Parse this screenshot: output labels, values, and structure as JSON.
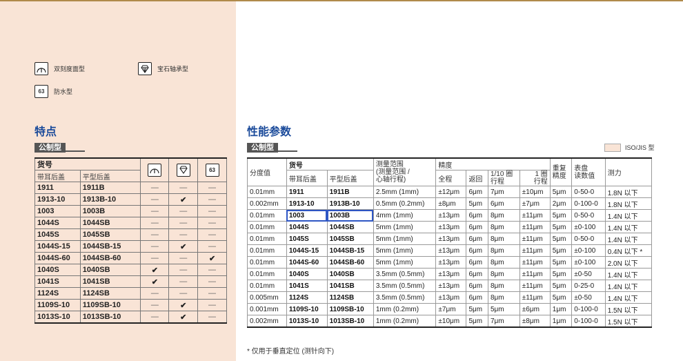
{
  "legend": {
    "items": [
      {
        "icon": "dual-dial-icon",
        "label": "双刻度面型"
      },
      {
        "icon": "jewel-bearing-icon",
        "label": "宝石轴承型"
      },
      {
        "icon": "waterproof-63-icon",
        "label": "防水型",
        "icon_text": "63"
      }
    ]
  },
  "features": {
    "title": "特点",
    "tag": "公制型",
    "header": {
      "item_no": "货号",
      "with_lug": "带耳后盖",
      "flat_back": "平型后盖"
    },
    "rows": [
      {
        "a": "1911",
        "b": "1911B",
        "m1": "—",
        "m2": "—",
        "m3": "—"
      },
      {
        "a": "1913-10",
        "b": "1913B-10",
        "m1": "—",
        "m2": "✔",
        "m3": "—"
      },
      {
        "a": "1003",
        "b": "1003B",
        "m1": "—",
        "m2": "—",
        "m3": "—"
      },
      {
        "a": "1044S",
        "b": "1044SB",
        "m1": "—",
        "m2": "—",
        "m3": "—"
      },
      {
        "a": "1045S",
        "b": "1045SB",
        "m1": "—",
        "m2": "—",
        "m3": "—"
      },
      {
        "a": "1044S-15",
        "b": "1044SB-15",
        "m1": "—",
        "m2": "✔",
        "m3": "—"
      },
      {
        "a": "1044S-60",
        "b": "1044SB-60",
        "m1": "—",
        "m2": "—",
        "m3": "✔"
      },
      {
        "a": "1040S",
        "b": "1040SB",
        "m1": "✔",
        "m2": "—",
        "m3": "—"
      },
      {
        "a": "1041S",
        "b": "1041SB",
        "m1": "✔",
        "m2": "—",
        "m3": "—"
      },
      {
        "a": "1124S",
        "b": "1124SB",
        "m1": "—",
        "m2": "—",
        "m3": "—"
      },
      {
        "a": "1109S-10",
        "b": "1109SB-10",
        "m1": "—",
        "m2": "✔",
        "m3": "—"
      },
      {
        "a": "1013S-10",
        "b": "1013SB-10",
        "m1": "—",
        "m2": "✔",
        "m3": "—"
      }
    ]
  },
  "performance": {
    "title": "性能参数",
    "tag": "公制型",
    "iso_legend": "ISO/JIS 型",
    "header": {
      "graduation": "分度值",
      "item_no": "货号",
      "with_lug": "带耳后盖",
      "flat_back": "平型后盖",
      "range": "测量范围\n(测量范围 /\n心轴行程)",
      "accuracy": "精度",
      "full": "全程",
      "retrace": "返回",
      "tenth": "1/10 圈\n行程",
      "one_rev": "1 圈\n行程",
      "repeat": "重复\n精度",
      "dial": "表盘\n读数值",
      "force": "测力"
    },
    "rows": [
      [
        "0.01mm",
        "1911",
        "1911B",
        "2.5mm (1mm)",
        "±12μm",
        "6μm",
        "7μm",
        "±10μm",
        "5μm",
        "0-50-0",
        "1.8N 以下"
      ],
      [
        "0.002mm",
        "1913-10",
        "1913B-10",
        "0.5mm (0.2mm)",
        "±8μm",
        "5μm",
        "6μm",
        "±7μm",
        "2μm",
        "0-100-0",
        "1.8N 以下"
      ],
      [
        "0.01mm",
        "1003",
        "1003B",
        "4mm (1mm)",
        "±13μm",
        "6μm",
        "8μm",
        "±11μm",
        "5μm",
        "0-50-0",
        "1.4N 以下"
      ],
      [
        "0.01mm",
        "1044S",
        "1044SB",
        "5mm (1mm)",
        "±13μm",
        "6μm",
        "8μm",
        "±11μm",
        "5μm",
        "±0-100",
        "1.4N 以下"
      ],
      [
        "0.01mm",
        "1045S",
        "1045SB",
        "5mm (1mm)",
        "±13μm",
        "6μm",
        "8μm",
        "±11μm",
        "5μm",
        "0-50-0",
        "1.4N 以下"
      ],
      [
        "0.01mm",
        "1044S-15",
        "1044SB-15",
        "5mm (1mm)",
        "±13μm",
        "6μm",
        "8μm",
        "±11μm",
        "5μm",
        "±0-100",
        "0.4N 以下 *"
      ],
      [
        "0.01mm",
        "1044S-60",
        "1044SB-60",
        "5mm (1mm)",
        "±13μm",
        "6μm",
        "8μm",
        "±11μm",
        "5μm",
        "±0-100",
        "2.0N 以下"
      ],
      [
        "0.01mm",
        "1040S",
        "1040SB",
        "3.5mm (0.5mm)",
        "±13μm",
        "6μm",
        "8μm",
        "±11μm",
        "5μm",
        "±0-50",
        "1.4N 以下"
      ],
      [
        "0.01mm",
        "1041S",
        "1041SB",
        "3.5mm (0.5mm)",
        "±13μm",
        "6μm",
        "8μm",
        "±11μm",
        "5μm",
        "0-25-0",
        "1.4N 以下"
      ],
      [
        "0.005mm",
        "1124S",
        "1124SB",
        "3.5mm (0.5mm)",
        "±13μm",
        "6μm",
        "8μm",
        "±11μm",
        "5μm",
        "±0-50",
        "1.4N 以下"
      ],
      [
        "0.001mm",
        "1109S-10",
        "1109SB-10",
        "1mm (0.2mm)",
        "±7μm",
        "5μm",
        "5μm",
        "±6μm",
        "1μm",
        "0-100-0",
        "1.5N 以下"
      ],
      [
        "0.002mm",
        "1013S-10",
        "1013SB-10",
        "1mm (0.2mm)",
        "±10μm",
        "5μm",
        "7μm",
        "±8μm",
        "1μm",
        "0-100-0",
        "1.5N 以下"
      ]
    ],
    "footnote": "* 仅用于垂直定位 (测针向下)"
  },
  "colors": {
    "accent_blue": "#1a4a9a",
    "highlight_border": "#2e56c4",
    "left_bg": "#f9e4d6"
  }
}
